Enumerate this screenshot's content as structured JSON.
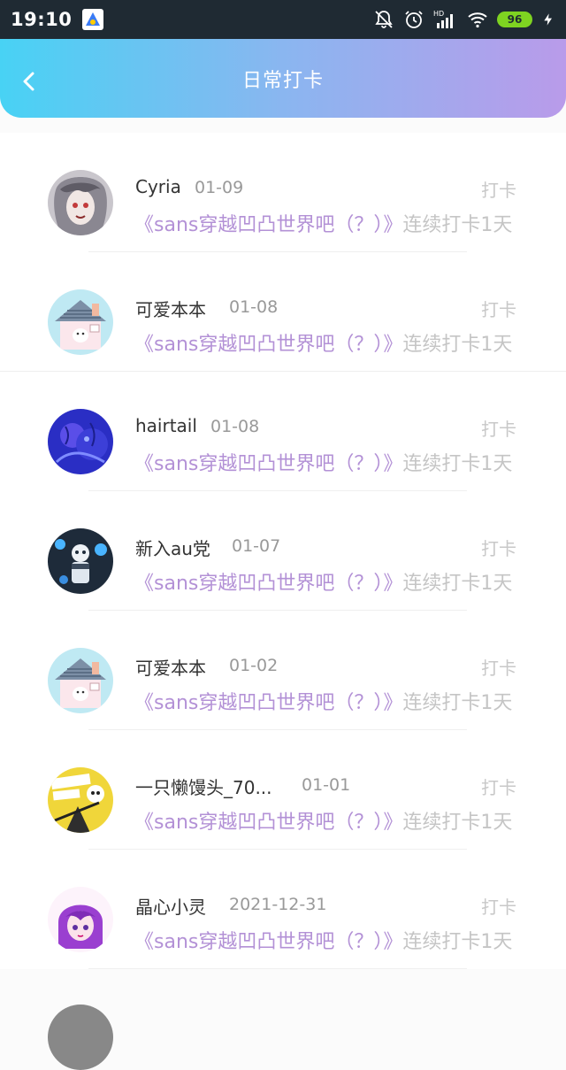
{
  "status_bar": {
    "time": "19:10",
    "battery": "96",
    "network": "HD",
    "icons": [
      "app-badge-icon",
      "bell-muted-icon",
      "alarm-icon",
      "signal-icon",
      "wifi-icon",
      "battery-icon",
      "charging-icon"
    ]
  },
  "header": {
    "title": "日常打卡",
    "back_icon": "chevron-left-icon"
  },
  "colors": {
    "header_gradient": [
      "#48d2f4",
      "#b99bea"
    ],
    "topic": "#b391d6",
    "muted": "#c5c5c5"
  },
  "entries": [
    {
      "user": "Cyria",
      "date": "01-09",
      "action": "打卡",
      "topic": "《sans穿越凹凸世界吧（？）》",
      "streak": "连续打卡1天"
    },
    {
      "user": "可爱本本",
      "date": "01-08",
      "action": "打卡",
      "topic": "《sans穿越凹凸世界吧（？）》",
      "streak": "连续打卡1天"
    },
    {
      "user": "hairtail",
      "date": "01-08",
      "action": "打卡",
      "topic": "《sans穿越凹凸世界吧（？）》",
      "streak": "连续打卡1天"
    },
    {
      "user": "新入au党",
      "date": "01-07",
      "action": "打卡",
      "topic": "《sans穿越凹凸世界吧（？）》",
      "streak": "连续打卡1天"
    },
    {
      "user": "可爱本本",
      "date": "01-02",
      "action": "打卡",
      "topic": "《sans穿越凹凸世界吧（？）》",
      "streak": "连续打卡1天"
    },
    {
      "user": "一只懒馒头_70...",
      "date": "01-01",
      "action": "打卡",
      "topic": "《sans穿越凹凸世界吧（？）》",
      "streak": "连续打卡1天"
    },
    {
      "user": "晶心小灵",
      "date": "2021-12-31",
      "action": "打卡",
      "topic": "《sans穿越凹凸世界吧（？）》",
      "streak": "连续打卡1天"
    }
  ]
}
